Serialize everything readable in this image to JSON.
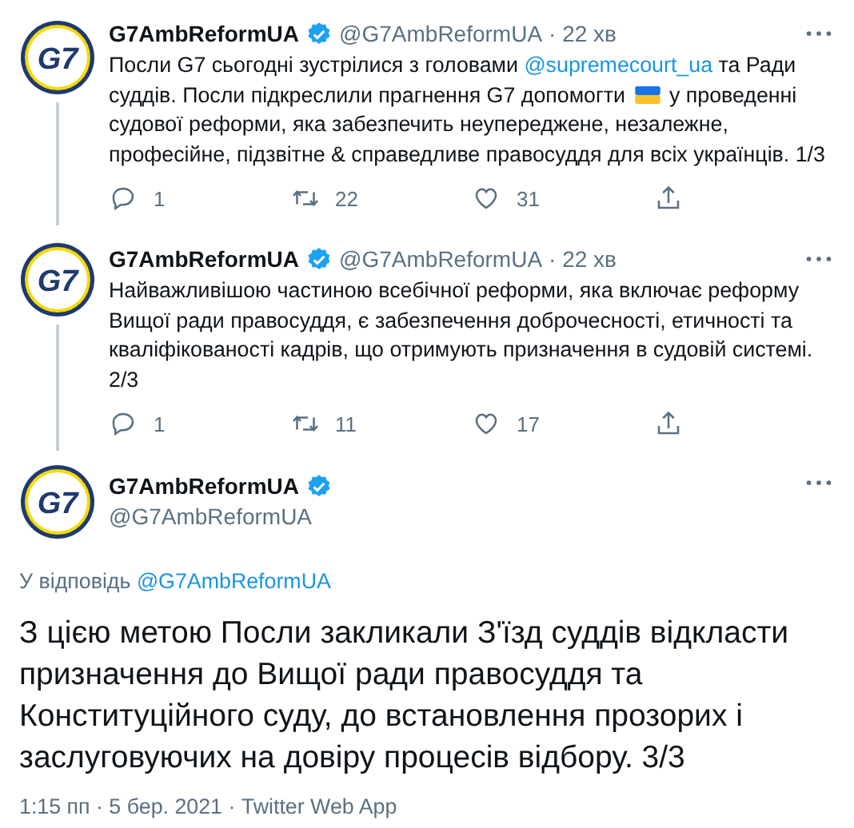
{
  "thread": [
    {
      "logo": "G7",
      "name": "G7AmbReformUA",
      "verified": true,
      "handle": "@G7AmbReformUA",
      "time": "· 22 хв",
      "body": [
        {
          "kind": "text",
          "text": "Посли G7 сьогодні зустрілися з головами "
        },
        {
          "kind": "mention",
          "text": "@supremecourt_ua"
        },
        {
          "kind": "text",
          "text": " та Ради суддів. Посли підкреслили прагнення G7 допомогти "
        },
        {
          "kind": "flag"
        },
        {
          "kind": "text",
          "text": " у проведенні судової реформи, яка забезпечить неупереджене, незалежне, професійне, підзвітне & справедливе правосуддя для всіх українців. 1/3"
        }
      ],
      "replies": "1",
      "retweets": "22",
      "likes": "31"
    },
    {
      "logo": "G7",
      "name": "G7AmbReformUA",
      "verified": true,
      "handle": "@G7AmbReformUA",
      "time": "· 22 хв",
      "body": [
        {
          "kind": "text",
          "text": "Найважливішою частиною всебічної реформи, яка включає реформу Вищої ради правосуддя, є забезпечення доброчесності, етичності та кваліфікованості кадрів, що отримують призначення в судовій системі. 2/3"
        }
      ],
      "replies": "1",
      "retweets": "11",
      "likes": "17"
    }
  ],
  "main": {
    "logo": "G7",
    "name": "G7AmbReformUA",
    "verified": true,
    "handle": "@G7AmbReformUA",
    "reply_label": "У відповідь",
    "reply_to": "@G7AmbReformUA",
    "text": "З цією метою Посли закликали З'їзд суддів відкласти призначення до Вищої ради правосуддя та Конституційного суду, до встановлення прозорих і заслуговуючих на довіру процесів відбору. 3/3",
    "meta": "1:15 пп · 5 бер. 2021 · Twitter Web App"
  }
}
